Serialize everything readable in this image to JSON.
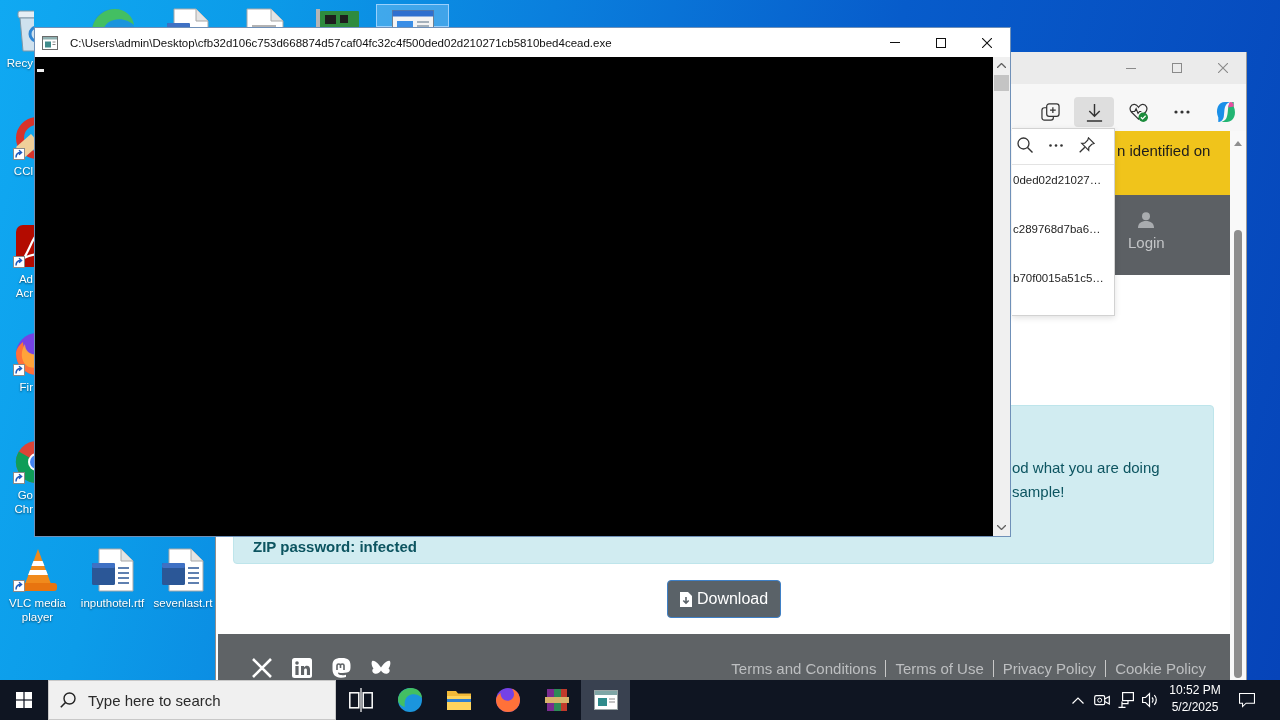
{
  "desktop": {
    "icons": [
      {
        "kind": "bin",
        "label": "Recy",
        "shortcut": false,
        "selected": false
      },
      {
        "kind": "swirl",
        "selected": false
      },
      {
        "kind": "wordfile",
        "selected": false
      },
      {
        "kind": "file",
        "selected": false
      },
      {
        "kind": "board",
        "selected": false
      },
      {
        "kind": "window",
        "selected": true
      },
      {
        "kind": "broom",
        "label": "CCl",
        "shortcut": true,
        "selected": false
      },
      {
        "kind": "pdf",
        "label": "Ad\nAcr",
        "shortcut": true,
        "selected": false
      },
      {
        "kind": "foxglobe",
        "label": "Fir",
        "shortcut": true,
        "selected": false
      },
      {
        "kind": "ringlogo",
        "label": "Go\nChr",
        "shortcut": true,
        "selected": false
      },
      {
        "kind": "cone",
        "label": "VLC media player",
        "shortcut": true,
        "selected": false
      },
      {
        "kind": "wordfile",
        "label": "inputhotel.rtf",
        "shortcut": false,
        "selected": false
      },
      {
        "kind": "wordfile",
        "label": "sevenlast.rt",
        "shortcut": false,
        "selected": false
      }
    ]
  },
  "console_window": {
    "title": "C:\\Users\\admin\\Desktop\\cfb32d106c753d668874d57caf04fc32c4f500ded02d210271cb5810bed4cead.exe"
  },
  "browser_window": {
    "toolbar": [
      {
        "kind": "collections",
        "active": false
      },
      {
        "kind": "downloads",
        "active": true
      },
      {
        "kind": "health",
        "active": false
      },
      {
        "kind": "more",
        "active": false
      },
      {
        "kind": "assistant",
        "active": false
      }
    ],
    "downloads_panel": {
      "items": [
        {
          "name": "0ded02d21027…"
        },
        {
          "name": "c289768d7ba6…"
        },
        {
          "name": "b70f0015a51c5…"
        }
      ]
    },
    "page": {
      "banner": "n identified on",
      "login": "Login",
      "alert": {
        "lines": [
          "od what you are doing",
          "sample!"
        ],
        "password": "ZIP password: infected"
      },
      "download_button": "Download",
      "footer": {
        "social": [
          {
            "kind": "x"
          },
          {
            "kind": "linkedin"
          },
          {
            "kind": "mastodon"
          },
          {
            "kind": "bluesky"
          }
        ],
        "links": [
          "Terms and Conditions",
          "Terms of Use",
          "Privacy Policy",
          "Cookie Policy"
        ]
      }
    }
  },
  "taskbar": {
    "search": {
      "placeholder": "Type here to search"
    },
    "apps": [
      {
        "kind": "taskview",
        "active": false
      },
      {
        "kind": "edge",
        "active": false
      },
      {
        "kind": "folder",
        "active": false
      },
      {
        "kind": "firefox",
        "active": false
      },
      {
        "kind": "archive",
        "active": false
      },
      {
        "kind": "console",
        "active": true
      }
    ],
    "clock": {
      "time": "10:52 PM",
      "date": "5/2/2025"
    }
  }
}
